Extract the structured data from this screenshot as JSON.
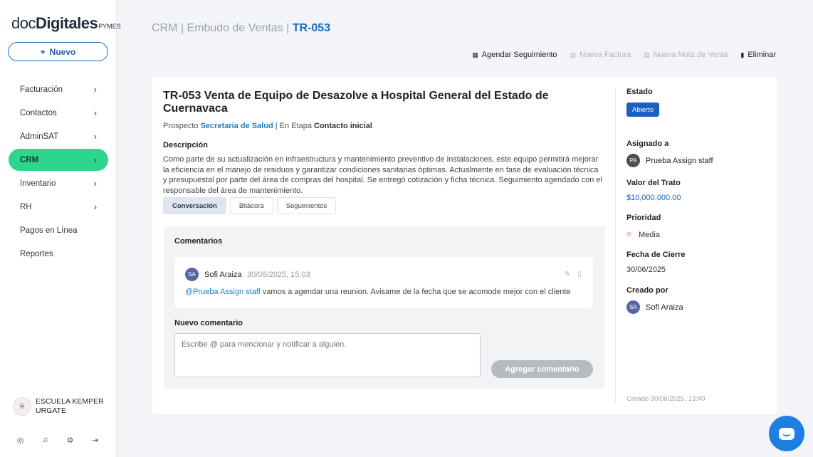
{
  "brand": {
    "doc": "doc",
    "digitales": "Digitales",
    "pymes": "PYMES"
  },
  "sidebar": {
    "new_button": "Nuevo",
    "items": [
      {
        "label": "Facturación",
        "chevron": true
      },
      {
        "label": "Contactos",
        "chevron": true
      },
      {
        "label": "AdminSAT",
        "chevron": true
      },
      {
        "label": "CRM",
        "chevron": true,
        "active": true
      },
      {
        "label": "Inventario",
        "chevron": true
      },
      {
        "label": "RH",
        "chevron": true
      },
      {
        "label": "Pagos en Línea",
        "chevron": false
      },
      {
        "label": "Reportes",
        "chevron": false
      }
    ],
    "company": {
      "line1": "ESCUELA KEMPER",
      "line2": "URGATE"
    },
    "bottom_icons": [
      "user-icon",
      "bell-icon",
      "gear-icon",
      "logout-icon"
    ]
  },
  "breadcrumb": {
    "part1": "CRM",
    "sep1": " | ",
    "part2": "Embudo de Ventas",
    "sep2": " | ",
    "current": "TR-053"
  },
  "actions": {
    "agendar": "Agendar Seguimiento",
    "nueva_factura": "Nueva Factura",
    "nueva_nota": "Nueva Nota de Venta",
    "eliminar": "Eliminar"
  },
  "deal": {
    "title": "TR-053  Venta de Equipo de Desazolve a Hospital General del Estado de Cuernavaca",
    "prospect_label": "Prospecto",
    "prospect": "Secretaria de Salud",
    "stage_label": "| En Etapa",
    "stage": "Contacto inicial",
    "description_label": "Descripción",
    "description": "Como parte de su actualización en infraestructura y mantenimiento preventivo de instalaciones, este equipo permitirá mejorar la eficiencia en el manejo de residuos y garantizar condiciones sanitarias óptimas. Actualmente en fase de evaluación técnica y presupuestal por parte del área de compras del hospital. Se entregó cotización y ficha técnica. Seguimiento agendado con el responsable del área de mantenimiento."
  },
  "tabs": [
    "Conversación",
    "Bitácora",
    "Seguimientos"
  ],
  "comments": {
    "title": "Comentarios",
    "items": [
      {
        "initials": "SA",
        "author": "Sofi Araiza",
        "date": "30/06/2025, 15:03",
        "mention": "@Prueba Assign staff",
        "text": " vamos a agendar una reunion. Avisame de la fecha que se acomode mejor con el cliente"
      }
    ],
    "new_label": "Nuevo comentario",
    "placeholder": "Escribe @ para mencionar y notificar a alguien.",
    "submit": "Agregar comentario"
  },
  "details": {
    "estado_label": "Estado",
    "estado": "Abierto",
    "asignado_label": "Asignado a",
    "asignado_initials": "PA",
    "asignado": "Prueba Assign staff",
    "valor_label": "Valor del Trato",
    "valor": "$10,000,000.00",
    "prioridad_label": "Prioridad",
    "prioridad": "Media",
    "cierre_label": "Fecha de Cierre",
    "cierre": "30/06/2025",
    "creado_por_label": "Creado por",
    "creado_por_initials": "SA",
    "creado_por": "Sofi Araiza",
    "creado": "Creado 30/06/2025, 13:40"
  },
  "colors": {
    "accent": "#1d5fc2",
    "active_nav": "#2ed58c",
    "chat": "#1d7fe0"
  }
}
